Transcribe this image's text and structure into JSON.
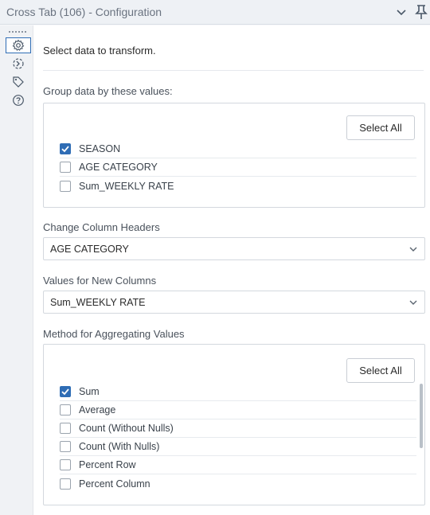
{
  "window": {
    "title": "Cross Tab (106) - Configuration"
  },
  "intro_text": "Select data to transform.",
  "group_section": {
    "label": "Group data by these values:",
    "select_all": "Select All",
    "items": [
      {
        "label": "SEASON",
        "checked": true
      },
      {
        "label": "AGE CATEGORY",
        "checked": false
      },
      {
        "label": "Sum_WEEKLY RATE",
        "checked": false
      }
    ]
  },
  "headers_section": {
    "label": "Change Column Headers",
    "value": "AGE CATEGORY"
  },
  "values_section": {
    "label": "Values for New Columns",
    "value": "Sum_WEEKLY RATE"
  },
  "method_section": {
    "label": "Method for Aggregating Values",
    "select_all": "Select All",
    "items": [
      {
        "label": "Sum",
        "checked": true
      },
      {
        "label": "Average",
        "checked": false
      },
      {
        "label": "Count (Without Nulls)",
        "checked": false
      },
      {
        "label": "Count (With Nulls)",
        "checked": false
      },
      {
        "label": "Percent Row",
        "checked": false
      },
      {
        "label": "Percent Column",
        "checked": false
      }
    ]
  },
  "colors": {
    "accent": "#2f6db5",
    "checkbox_checked": "#2f6db5"
  },
  "sidebar_icons": [
    "gear-icon",
    "connector-icon",
    "tag-icon",
    "help-icon"
  ]
}
